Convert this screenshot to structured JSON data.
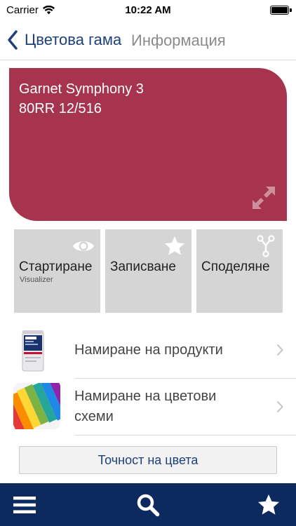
{
  "status_bar": {
    "carrier": "Carrier",
    "time": "10:22 AM"
  },
  "nav": {
    "back_label": "Цветова гама",
    "title": "Информация"
  },
  "swatch": {
    "color": "#a6344e",
    "name_line1": "Garnet Symphony 3",
    "name_line2": "80RR 12/516"
  },
  "tiles": [
    {
      "label": "Стартиране",
      "sublabel": "Visualizer",
      "icon": "eye-icon"
    },
    {
      "label": "Записване",
      "sublabel": "",
      "icon": "star-icon"
    },
    {
      "label": "Споделяне",
      "sublabel": "",
      "icon": "share-icon"
    }
  ],
  "list": [
    {
      "label": "Намиране на продукти",
      "icon": "paint-can-icon"
    },
    {
      "label_line1": "Намиране на цветови",
      "label_line2": "схеми",
      "icon": "color-swatches-icon"
    }
  ],
  "accuracy_button": {
    "label": "Точност на цвета"
  },
  "tab_bar": {
    "items": [
      "menu-icon",
      "search-icon",
      "star-icon"
    ],
    "background": "#0c2a5e"
  },
  "colors": {
    "accent": "#1d3f7c",
    "tile_bg": "#d5d5d5"
  }
}
